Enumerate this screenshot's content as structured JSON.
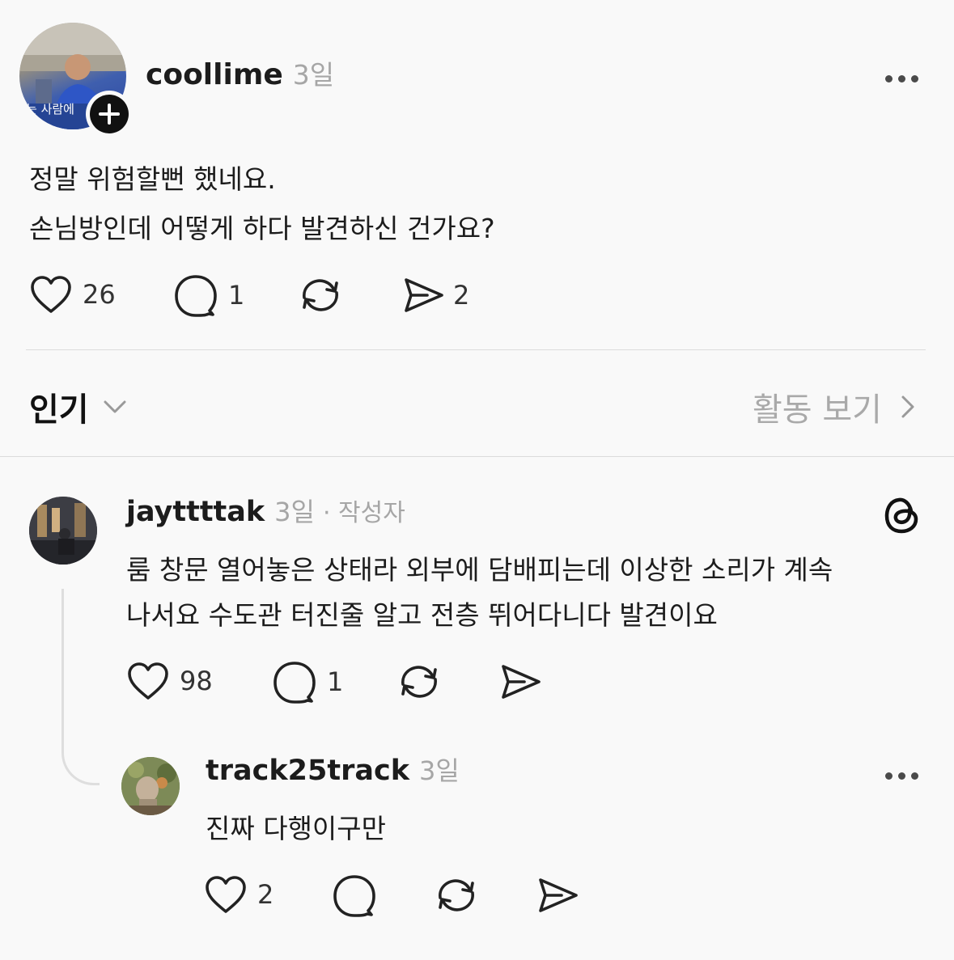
{
  "post": {
    "username": "coollime",
    "time": "3일",
    "body_lines": [
      "정말 위험할뻔 했네요.",
      "손님방인데 어떻게 하다 발견하신 건가요?"
    ],
    "avatar_caption": "는 사람에",
    "stats": {
      "likes": "26",
      "comments": "1",
      "shares": "2"
    }
  },
  "sort_bar": {
    "sort_label": "인기",
    "activity_link": "활동 보기"
  },
  "comments": [
    {
      "username": "jayttttak",
      "time": "3일",
      "author_badge": "· 작성자",
      "body_lines": [
        "룸 창문 열어놓은 상태라 외부에 담배피는데 이상한 소리가 계속",
        "나서요 수도관 터진줄 알고 전층 뛰어다니다 발견이요"
      ],
      "stats": {
        "likes": "98",
        "comments": "1"
      }
    },
    {
      "username": "track25track",
      "time": "3일",
      "body_lines": [
        "진짜 다행이구만"
      ],
      "stats": {
        "likes": "2"
      }
    }
  ]
}
